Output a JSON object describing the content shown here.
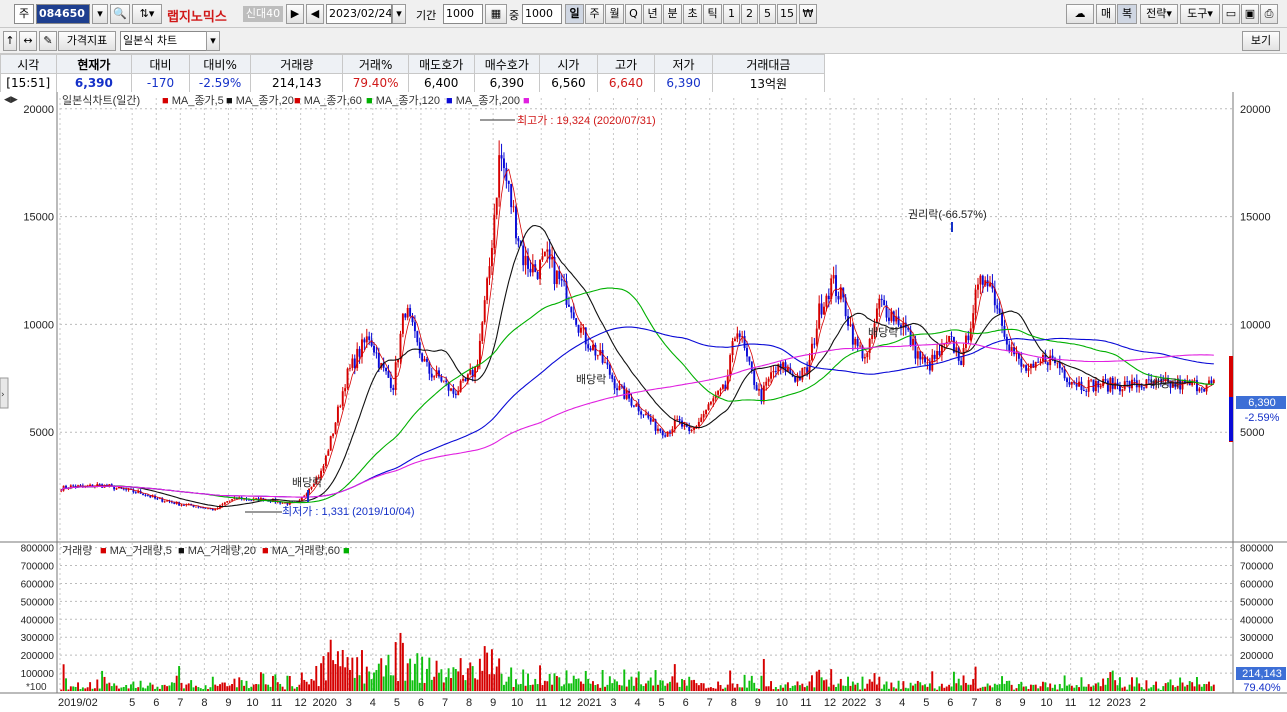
{
  "toolbar": {
    "market_label": "주",
    "stock_code": "084650",
    "stock_name": "랩지노믹스",
    "credit_badge": "신대40",
    "date": "2023/02/24",
    "period_label": "기간",
    "period_value": "1000",
    "count_label": "중",
    "count_value": "1000",
    "timeframes": [
      "일",
      "주",
      "월",
      "Q",
      "년",
      "분",
      "초",
      "틱",
      "1",
      "2",
      "5",
      "15"
    ],
    "right_buttons": [
      "매",
      "복",
      "전략",
      "도구"
    ],
    "indicator_button": "가격지표",
    "chart_type": "일본식 차트",
    "view_button": "보기"
  },
  "quote": {
    "headers": [
      "시각",
      "현재가",
      "대비",
      "대비%",
      "거래량",
      "거래%",
      "매도호가",
      "매수호가",
      "시가",
      "고가",
      "저가",
      "거래대금"
    ],
    "values": [
      "[15:51]",
      "6,390",
      "-170",
      "-2.59%",
      "214,143",
      "79.40%",
      "6,400",
      "6,390",
      "6,560",
      "6,640",
      "6,390",
      "13억원"
    ]
  },
  "colors": {
    "up": "#d60000",
    "down": "#0a0ad6",
    "ma5": "#d60000",
    "ma20": "#111111",
    "ma60": "#d60000",
    "ma120": "#00b000",
    "ma200": "#0a0ad6",
    "ma_extra": "#e020e0"
  },
  "chart_data": {
    "type": "candlestick",
    "price_legend": [
      "일본식차트(일간)",
      "MA_종가,5",
      "MA_종가,20",
      "MA_종가,60",
      "MA_종가,120",
      "MA_종가,200"
    ],
    "volume_legend": [
      "거래량",
      "MA_거래량,5",
      "MA_거래량,20",
      "MA_거래량,60"
    ],
    "price_ylim": [
      0,
      20500
    ],
    "price_ticks": [
      5000,
      10000,
      15000,
      20000
    ],
    "volume_ylim": [
      0,
      820000
    ],
    "volume_ticks": [
      100000,
      200000,
      300000,
      400000,
      500000,
      600000,
      700000,
      800000
    ],
    "volume_unit": "*100",
    "x_labels": [
      "2019/02",
      "5",
      "6",
      "7",
      "8",
      "9",
      "10",
      "11",
      "12",
      "2020",
      "3",
      "4",
      "5",
      "6",
      "7",
      "8",
      "9",
      "10",
      "11",
      "12",
      "2021",
      "3",
      "4",
      "5",
      "6",
      "7",
      "8",
      "9",
      "10",
      "11",
      "12",
      "2022",
      "3",
      "4",
      "5",
      "6",
      "7",
      "8",
      "9",
      "10",
      "11",
      "12",
      "2023",
      "2"
    ],
    "price_series_months": [
      0,
      0.5,
      1,
      1.5,
      2,
      2.5,
      3,
      3.5,
      4,
      4.5,
      5,
      5.5,
      6,
      6.5,
      7,
      7.5,
      8,
      8.5,
      9,
      9.5,
      10,
      10.5,
      11,
      11.5,
      12,
      12.5,
      13,
      13.5,
      14,
      14.5,
      15,
      15.5,
      16,
      16.5,
      17,
      17.5,
      18,
      18.5,
      19,
      19.5,
      20,
      20.5,
      21,
      21.5,
      22,
      22.5,
      23,
      23.5,
      24,
      24.5,
      25,
      25.5,
      26,
      26.5,
      27,
      27.5,
      28,
      28.5,
      29,
      29.5,
      30,
      30.5,
      31,
      31.5,
      32,
      32.5,
      33,
      33.5,
      34,
      34.5,
      35,
      35.5,
      36,
      36.5,
      37,
      37.5,
      38,
      38.5,
      39,
      39.5,
      40,
      40.5,
      41,
      41.5,
      42,
      42.5,
      43
    ],
    "price_close": [
      2400,
      2500,
      2450,
      2550,
      2500,
      2350,
      2250,
      2150,
      1900,
      1800,
      1650,
      1600,
      1500,
      1400,
      1800,
      1950,
      1850,
      1900,
      1800,
      1700,
      1700,
      2500,
      3200,
      5200,
      7500,
      8600,
      9500,
      8000,
      7200,
      10800,
      9000,
      7800,
      7500,
      6800,
      7200,
      8000,
      12000,
      18000,
      15500,
      13000,
      12500,
      13000,
      12000,
      11000,
      9500,
      8800,
      8000,
      7000,
      6500,
      6000,
      5300,
      5000,
      5500,
      4900,
      5700,
      6500,
      7000,
      10000,
      8000,
      6600,
      7800,
      8000,
      7500,
      7900,
      10800,
      12000,
      11000,
      9000,
      8500,
      11000,
      10500,
      10000,
      8800,
      8000,
      8600,
      9200,
      8300,
      11000,
      12500,
      10800,
      9000,
      8000,
      7800,
      8500,
      8200,
      7500,
      7200,
      6500
    ]
  },
  "annotations": {
    "high": "최고가 : 19,324 (2020/07/31)",
    "low": "최저가 : 1,331 (2019/10/04)",
    "rights": "권리락(-66.57%)",
    "div1": "배당락",
    "div2": "배당락",
    "div3": "배당락",
    "div4": "배당락",
    "last_price": "6,390",
    "last_pct": "-2.59%",
    "last_volume": "214,143",
    "last_volume_pct": "79.40%"
  }
}
